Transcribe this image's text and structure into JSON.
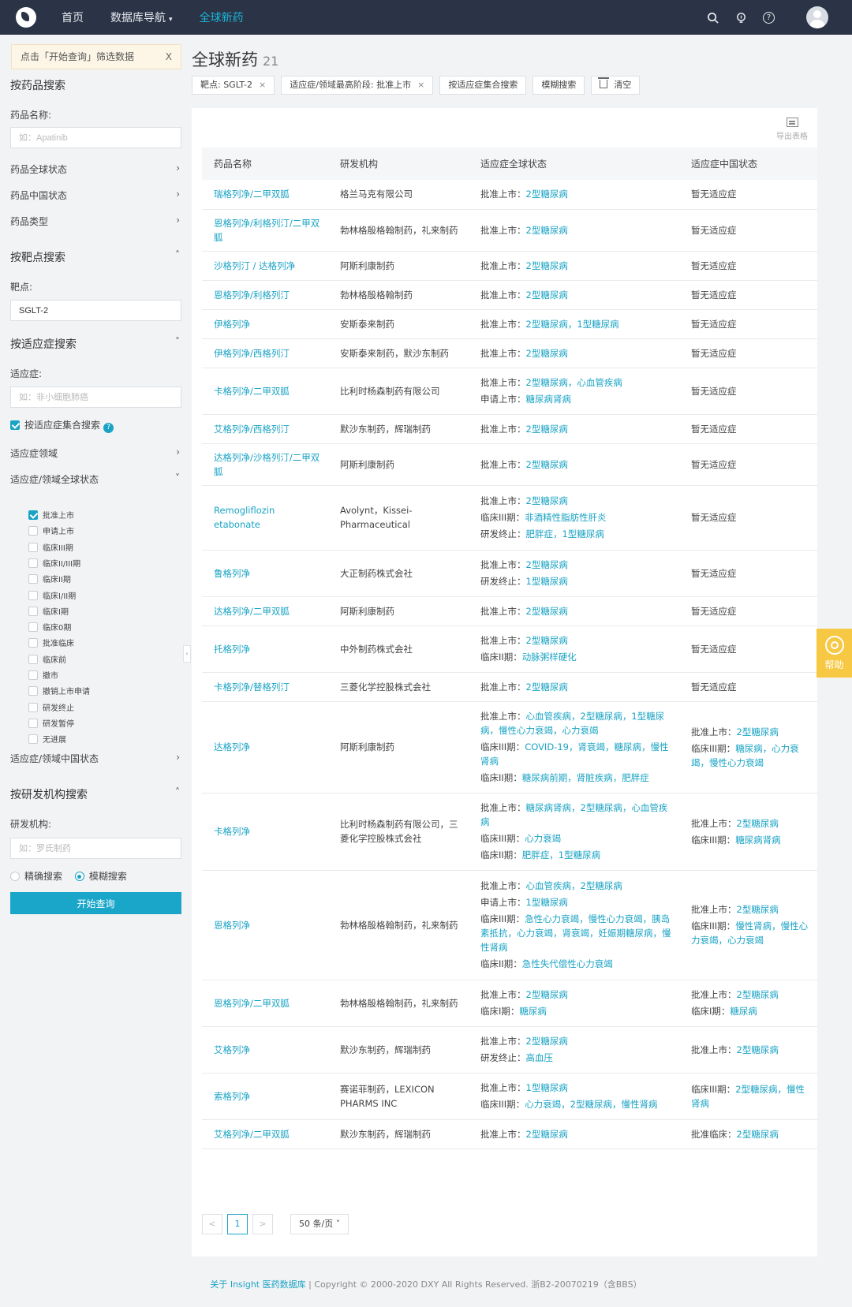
{
  "nav": {
    "home": "首页",
    "db_nav": "数据库导航",
    "current": "全球新药"
  },
  "sidebar": {
    "tip": "点击「开始查询」筛选数据",
    "tip_close": "X",
    "drug_search": {
      "title": "按药品搜索",
      "name_label": "药品名称:",
      "name_placeholder": "如：Apatinib",
      "rows": [
        "药品全球状态",
        "药品中国状态",
        "药品类型"
      ]
    },
    "target_search": {
      "title": "按靶点搜索",
      "label": "靶点:",
      "value": "SGLT-2"
    },
    "indication_search": {
      "title": "按适应症搜索",
      "label": "适应症:",
      "placeholder": "如：非小细胞肺癌",
      "set_search": "按适应症集合搜索",
      "area_label": "适应症领域",
      "global_status_label": "适应症/领域全球状态",
      "statuses": [
        {
          "label": "批准上市",
          "checked": true
        },
        {
          "label": "申请上市",
          "checked": false
        },
        {
          "label": "临床III期",
          "checked": false
        },
        {
          "label": "临床II/III期",
          "checked": false
        },
        {
          "label": "临床II期",
          "checked": false
        },
        {
          "label": "临床I/II期",
          "checked": false
        },
        {
          "label": "临床I期",
          "checked": false
        },
        {
          "label": "临床0期",
          "checked": false
        },
        {
          "label": "批准临床",
          "checked": false
        },
        {
          "label": "临床前",
          "checked": false
        },
        {
          "label": "撤市",
          "checked": false
        },
        {
          "label": "撤销上市申请",
          "checked": false
        },
        {
          "label": "研发终止",
          "checked": false
        },
        {
          "label": "研发暂停",
          "checked": false
        },
        {
          "label": "无进展",
          "checked": false
        }
      ],
      "china_status_label": "适应症/领域中国状态"
    },
    "org_search": {
      "title": "按研发机构搜索",
      "label": "研发机构:",
      "placeholder": "如：罗氏制药",
      "exact": "精确搜索",
      "fuzzy": "模糊搜索"
    },
    "query_button": "开始查询"
  },
  "main": {
    "title": "全球新药",
    "count": "21",
    "chips": [
      {
        "label": "靶点: SGLT-2",
        "closable": true
      },
      {
        "label": "适应症/领域最高阶段: 批准上市",
        "closable": true
      },
      {
        "label": "按适应症集合搜索",
        "closable": false
      },
      {
        "label": "模糊搜索",
        "closable": false
      }
    ],
    "clear_label": "清空",
    "export_label": "导出表格",
    "columns": [
      "药品名称",
      "研发机构",
      "适应症全球状态",
      "适应症中国状态"
    ],
    "rows": [
      {
        "drug": "瑞格列净/二甲双胍",
        "org": "格兰马克有限公司",
        "global": [
          [
            "批准上市：",
            "2型糖尿病"
          ]
        ],
        "china": [
          [
            "",
            "暂无适应症"
          ]
        ]
      },
      {
        "drug": "恩格列净/利格列汀/二甲双胍",
        "org": "勃林格殷格翰制药，礼来制药",
        "global": [
          [
            "批准上市：",
            "2型糖尿病"
          ]
        ],
        "china": [
          [
            "",
            "暂无适应症"
          ]
        ]
      },
      {
        "drug": "沙格列汀 / 达格列净",
        "org": "阿斯利康制药",
        "global": [
          [
            "批准上市：",
            "2型糖尿病"
          ]
        ],
        "china": [
          [
            "",
            "暂无适应症"
          ]
        ]
      },
      {
        "drug": "恩格列净/利格列汀",
        "org": "勃林格殷格翰制药",
        "global": [
          [
            "批准上市：",
            "2型糖尿病"
          ]
        ],
        "china": [
          [
            "",
            "暂无适应症"
          ]
        ]
      },
      {
        "drug": "伊格列净",
        "org": "安斯泰来制药",
        "global": [
          [
            "批准上市：",
            "2型糖尿病，1型糖尿病"
          ]
        ],
        "china": [
          [
            "",
            "暂无适应症"
          ]
        ]
      },
      {
        "drug": "伊格列净/西格列汀",
        "org": "安斯泰来制药，默沙东制药",
        "global": [
          [
            "批准上市：",
            "2型糖尿病"
          ]
        ],
        "china": [
          [
            "",
            "暂无适应症"
          ]
        ]
      },
      {
        "drug": "卡格列净/二甲双胍",
        "org": "比利时杨森制药有限公司",
        "global": [
          [
            "批准上市：",
            "2型糖尿病，心血管疾病"
          ],
          [
            "申请上市：",
            "糖尿病肾病"
          ]
        ],
        "china": [
          [
            "",
            "暂无适应症"
          ]
        ]
      },
      {
        "drug": "艾格列净/西格列汀",
        "org": "默沙东制药，辉瑞制药",
        "global": [
          [
            "批准上市：",
            "2型糖尿病"
          ]
        ],
        "china": [
          [
            "",
            "暂无适应症"
          ]
        ]
      },
      {
        "drug": "达格列净/沙格列汀/二甲双胍",
        "org": "阿斯利康制药",
        "global": [
          [
            "批准上市：",
            "2型糖尿病"
          ]
        ],
        "china": [
          [
            "",
            "暂无适应症"
          ]
        ]
      },
      {
        "drug": "Remogliflozin etabonate",
        "org": "Avolynt，Kissei-Pharmaceutical",
        "global": [
          [
            "批准上市：",
            "2型糖尿病"
          ],
          [
            "临床III期：",
            "非酒精性脂肪性肝炎"
          ],
          [
            "研发终止：",
            "肥胖症，1型糖尿病"
          ]
        ],
        "china": [
          [
            "",
            "暂无适应症"
          ]
        ]
      },
      {
        "drug": "鲁格列净",
        "org": "大正制药株式会社",
        "global": [
          [
            "批准上市：",
            "2型糖尿病"
          ],
          [
            "研发终止：",
            "1型糖尿病"
          ]
        ],
        "china": [
          [
            "",
            "暂无适应症"
          ]
        ]
      },
      {
        "drug": "达格列净/二甲双胍",
        "org": "阿斯利康制药",
        "global": [
          [
            "批准上市：",
            "2型糖尿病"
          ]
        ],
        "china": [
          [
            "",
            "暂无适应症"
          ]
        ]
      },
      {
        "drug": "托格列净",
        "org": "中外制药株式会社",
        "global": [
          [
            "批准上市：",
            "2型糖尿病"
          ],
          [
            "临床II期：",
            "动脉粥样硬化"
          ]
        ],
        "china": [
          [
            "",
            "暂无适应症"
          ]
        ]
      },
      {
        "drug": "卡格列净/替格列汀",
        "org": "三菱化学控股株式会社",
        "global": [
          [
            "批准上市：",
            "2型糖尿病"
          ]
        ],
        "china": [
          [
            "",
            "暂无适应症"
          ]
        ]
      },
      {
        "drug": "达格列净",
        "org": "阿斯利康制药",
        "global": [
          [
            "批准上市：",
            "心血管疾病，2型糖尿病，1型糖尿病，慢性心力衰竭，心力衰竭"
          ],
          [
            "临床III期：",
            "COVID-19，肾衰竭，糖尿病，慢性肾病"
          ],
          [
            "临床II期：",
            "糖尿病前期，肾脏疾病，肥胖症"
          ]
        ],
        "china": [
          [
            "批准上市：",
            "2型糖尿病"
          ],
          [
            "临床III期：",
            "糖尿病，心力衰竭，慢性心力衰竭"
          ]
        ]
      },
      {
        "drug": "卡格列净",
        "org": "比利时杨森制药有限公司，三菱化学控股株式会社",
        "global": [
          [
            "批准上市：",
            "糖尿病肾病，2型糖尿病，心血管疾病"
          ],
          [
            "临床III期：",
            "心力衰竭"
          ],
          [
            "临床II期：",
            "肥胖症，1型糖尿病"
          ]
        ],
        "china": [
          [
            "批准上市：",
            "2型糖尿病"
          ],
          [
            "临床III期：",
            "糖尿病肾病"
          ]
        ]
      },
      {
        "drug": "恩格列净",
        "org": "勃林格殷格翰制药，礼来制药",
        "global": [
          [
            "批准上市：",
            "心血管疾病，2型糖尿病"
          ],
          [
            "申请上市：",
            "1型糖尿病"
          ],
          [
            "临床III期：",
            "急性心力衰竭，慢性心力衰竭，胰岛素抵抗，心力衰竭，肾衰竭，妊娠期糖尿病，慢性肾病"
          ],
          [
            "临床II期：",
            "急性失代偿性心力衰竭"
          ]
        ],
        "china": [
          [
            "批准上市：",
            "2型糖尿病"
          ],
          [
            "临床III期：",
            "慢性肾病，慢性心力衰竭，心力衰竭"
          ]
        ]
      },
      {
        "drug": "恩格列净/二甲双胍",
        "org": "勃林格殷格翰制药，礼来制药",
        "global": [
          [
            "批准上市：",
            "2型糖尿病"
          ],
          [
            "临床I期：",
            "糖尿病"
          ]
        ],
        "china": [
          [
            "批准上市：",
            "2型糖尿病"
          ],
          [
            "临床I期：",
            "糖尿病"
          ]
        ]
      },
      {
        "drug": "艾格列净",
        "org": "默沙东制药，辉瑞制药",
        "global": [
          [
            "批准上市：",
            "2型糖尿病"
          ],
          [
            "研发终止：",
            "高血压"
          ]
        ],
        "china": [
          [
            "批准上市：",
            "2型糖尿病"
          ]
        ]
      },
      {
        "drug": "索格列净",
        "org": "赛诺菲制药，LEXICON PHARMS INC",
        "global": [
          [
            "批准上市：",
            "1型糖尿病"
          ],
          [
            "临床III期：",
            "心力衰竭，2型糖尿病，慢性肾病"
          ]
        ],
        "china": [
          [
            "临床III期：",
            "2型糖尿病，慢性肾病"
          ]
        ]
      },
      {
        "drug": "艾格列净/二甲双胍",
        "org": "默沙东制药，辉瑞制药",
        "global": [
          [
            "批准上市：",
            "2型糖尿病"
          ]
        ],
        "china": [
          [
            "批准临床：",
            "2型糖尿病"
          ]
        ]
      }
    ],
    "pager": {
      "prev": "<",
      "current": "1",
      "next": ">",
      "page_size": "50 条/页"
    }
  },
  "help_label": "帮助",
  "footer": {
    "link": "关于 Insight 医药数据库",
    "text": "Copyright © 2000-2020 DXY All Rights Reserved. 浙B2-20070219（含BBS）"
  }
}
